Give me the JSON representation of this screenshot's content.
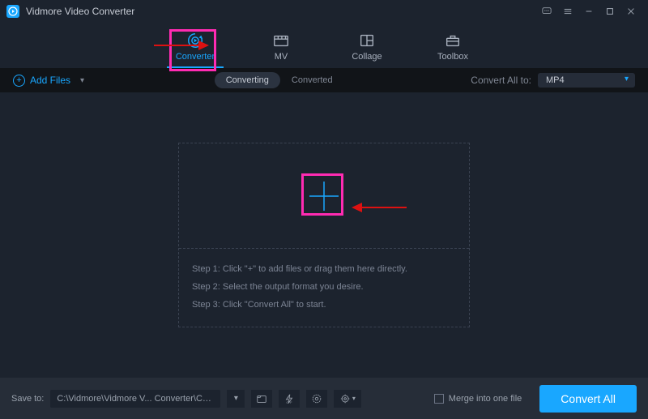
{
  "window": {
    "title": "Vidmore Video Converter"
  },
  "nav": {
    "tabs": [
      {
        "label": "Converter",
        "active": true
      },
      {
        "label": "MV"
      },
      {
        "label": "Collage"
      },
      {
        "label": "Toolbox"
      }
    ]
  },
  "toolbar": {
    "add_files": "Add Files",
    "segments": {
      "converting": "Converting",
      "converted": "Converted"
    },
    "convert_all_to_label": "Convert All to:",
    "format_selected": "MP4"
  },
  "drop": {
    "step1": "Step 1: Click \"+\" to add files or drag them here directly.",
    "step2": "Step 2: Select the output format you desire.",
    "step3": "Step 3: Click \"Convert All\" to start."
  },
  "footer": {
    "save_to_label": "Save to:",
    "save_to_path": "C:\\Vidmore\\Vidmore V... Converter\\Converted",
    "merge_label": "Merge into one file",
    "convert_all": "Convert All"
  },
  "icons": {
    "feedback": "feedback-icon",
    "menu": "menu-icon",
    "minimize": "minimize-icon",
    "maximize": "maximize-icon",
    "close": "close-icon"
  }
}
